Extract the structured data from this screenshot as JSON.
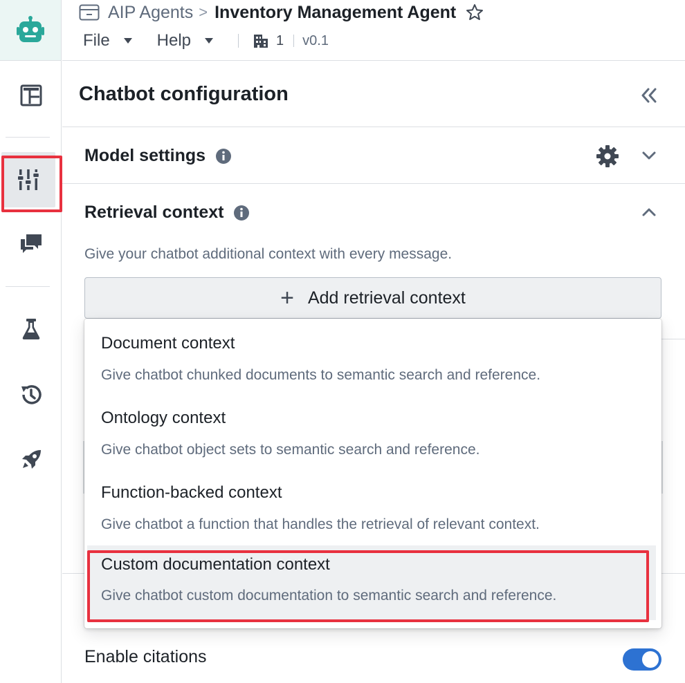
{
  "breadcrumb": {
    "parent": "AIP Agents",
    "separator": ">",
    "current": "Inventory Management Agent"
  },
  "menus": {
    "file": "File",
    "help": "Help",
    "org_count": "1",
    "version": "v0.1"
  },
  "rail": {
    "items": [
      "layout-icon",
      "sliders-icon",
      "chat-icon",
      "flask-icon",
      "history-icon",
      "rocket-icon"
    ],
    "active": "sliders-icon"
  },
  "panel": {
    "title": "Chatbot configuration"
  },
  "sections": {
    "model_settings": "Model settings",
    "retrieval_context": "Retrieval context",
    "retrieval_description": "Give your chatbot additional context with every message.",
    "add_button": "Add retrieval context"
  },
  "dropdown": {
    "items": [
      {
        "title": "Document context",
        "description": "Give chatbot chunked documents to semantic search and reference."
      },
      {
        "title": "Ontology context",
        "description": "Give chatbot object sets to semantic search and reference."
      },
      {
        "title": "Function-backed context",
        "description": "Give chatbot a function that handles the retrieval of relevant context."
      },
      {
        "title": "Custom documentation context",
        "description": "Give chatbot custom documentation to semantic search and reference."
      }
    ],
    "highlighted_index": 3
  },
  "citations": {
    "label": "Enable citations",
    "enabled": true
  },
  "colors": {
    "accent": "#2d72d2",
    "highlight_border": "#e8313f",
    "logo": "#2aa89a"
  }
}
